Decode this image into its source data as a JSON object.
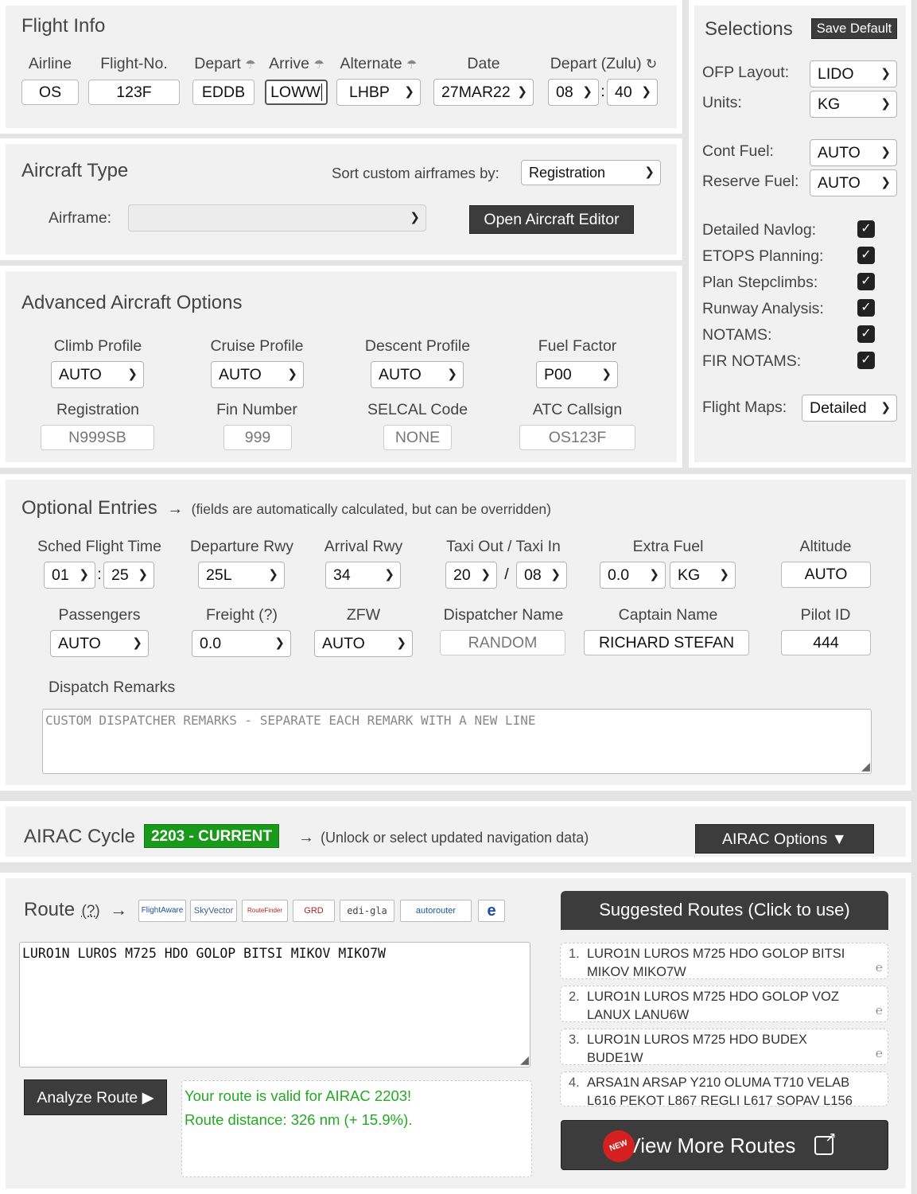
{
  "flight_info": {
    "title": "Flight Info",
    "labels": {
      "airline": "Airline",
      "flight_no": "Flight-No.",
      "depart": "Depart",
      "arrive": "Arrive",
      "alternate": "Alternate",
      "date": "Date",
      "depart_zulu": "Depart (Zulu)"
    },
    "airline": "OS",
    "flight_no": "123F",
    "depart": "EDDB",
    "arrive": "LOWW",
    "alternate": "LHBP",
    "date": "27MAR22",
    "dep_hour": "08",
    "dep_min": "40",
    "time_sep": ":"
  },
  "aircraft_type": {
    "title": "Aircraft Type",
    "sort_label": "Sort custom airframes by:",
    "sort_value": "Registration",
    "airframe_label": "Airframe:",
    "airframe_value": "",
    "editor_button": "Open Aircraft Editor"
  },
  "advanced": {
    "title": "Advanced Aircraft Options",
    "labels": {
      "climb": "Climb Profile",
      "cruise": "Cruise Profile",
      "descent": "Descent Profile",
      "fuel_factor": "Fuel Factor",
      "registration": "Registration",
      "fin": "Fin Number",
      "selcal": "SELCAL Code",
      "callsign": "ATC Callsign"
    },
    "climb": "AUTO",
    "cruise": "AUTO",
    "descent": "AUTO",
    "fuel_factor": "P00",
    "registration_ph": "N999SB",
    "fin_ph": "999",
    "selcal_ph": "NONE",
    "callsign_ph": "OS123F"
  },
  "selections": {
    "title": "Selections",
    "save_default": "Save Default",
    "ofp_label": "OFP Layout:",
    "ofp": "LIDO",
    "units_label": "Units:",
    "units": "KG",
    "cont_label": "Cont Fuel:",
    "cont": "AUTO",
    "reserve_label": "Reserve Fuel:",
    "reserve": "AUTO",
    "checks": [
      {
        "label": "Detailed Navlog:",
        "checked": true
      },
      {
        "label": "ETOPS Planning:",
        "checked": true
      },
      {
        "label": "Plan Stepclimbs:",
        "checked": true
      },
      {
        "label": "Runway Analysis:",
        "checked": true
      },
      {
        "label": "NOTAMS:",
        "checked": true
      },
      {
        "label": "FIR NOTAMS:",
        "checked": true
      }
    ],
    "maps_label": "Flight Maps:",
    "maps": "Detailed"
  },
  "optional": {
    "title": "Optional Entries",
    "arrow": "→",
    "subtitle": "(fields are automatically calculated, but can be overridden)",
    "labels": {
      "sched": "Sched Flight Time",
      "dep_rwy": "Departure Rwy",
      "arr_rwy": "Arrival Rwy",
      "taxi": "Taxi Out / Taxi In",
      "extra_fuel": "Extra Fuel",
      "altitude": "Altitude",
      "pax": "Passengers",
      "freight": "Freight (?)",
      "zfw": "ZFW",
      "dispatcher": "Dispatcher Name",
      "captain": "Captain Name",
      "pilot_id": "Pilot ID",
      "remarks": "Dispatch Remarks"
    },
    "sched_h": "01",
    "sched_m": "25",
    "sep_colon": ":",
    "dep_rwy": "25L",
    "arr_rwy": "34",
    "taxi_out": "20",
    "taxi_in": "08",
    "sep_slash": "/",
    "extra_fuel": "0.0",
    "extra_unit": "KG",
    "altitude": "AUTO",
    "pax": "AUTO",
    "freight": "0.0",
    "zfw": "AUTO",
    "dispatcher_ph": "RANDOM",
    "captain": "RICHARD STEFAN",
    "pilot_id": "444",
    "remarks_ph": "CUSTOM DISPATCHER REMARKS - SEPARATE EACH REMARK WITH A NEW LINE"
  },
  "airac": {
    "title": "AIRAC Cycle",
    "badge": "2203 - CURRENT",
    "arrow": "→",
    "note": "(Unlock or select updated navigation data)",
    "button": "AIRAC Options ▼",
    "badge_color": "#1a9a1a"
  },
  "route": {
    "title": "Route",
    "help": "(?)",
    "arrow": "→",
    "logos": [
      "FlightAware",
      "SkyVector",
      "RouteFinder",
      "GRD",
      "edi-gla",
      "autorouter",
      "Eurocontrol"
    ],
    "text": "LURO1N LUROS M725 HDO GOLOP BITSI MIKOV MIKO7W",
    "analyze": "Analyze Route ▶",
    "valid_msg": "Your route is valid for AIRAC 2203!",
    "distance_msg": "Route distance: 326 nm (+ 15.9%).",
    "msg_color": "#22aa22",
    "suggested_title": "Suggested Routes (Click to use)",
    "suggestions": [
      {
        "num": "1.",
        "text": "LURO1N LUROS M725 HDO GOLOP BITSI MIKOV MIKO7W"
      },
      {
        "num": "2.",
        "text": "LURO1N LUROS M725 HDO GOLOP VOZ LANUX LANU6W"
      },
      {
        "num": "3.",
        "text": "LURO1N LUROS M725 HDO BUDEX BUDE1W"
      },
      {
        "num": "4.",
        "text": "ARSA1N ARSAP Y210 OLUMA T710 VELAB L616 PEKOT L867 REGLI L617 SOPAV L156"
      }
    ],
    "new_badge": "NEW",
    "more_routes": "View More Routes"
  }
}
